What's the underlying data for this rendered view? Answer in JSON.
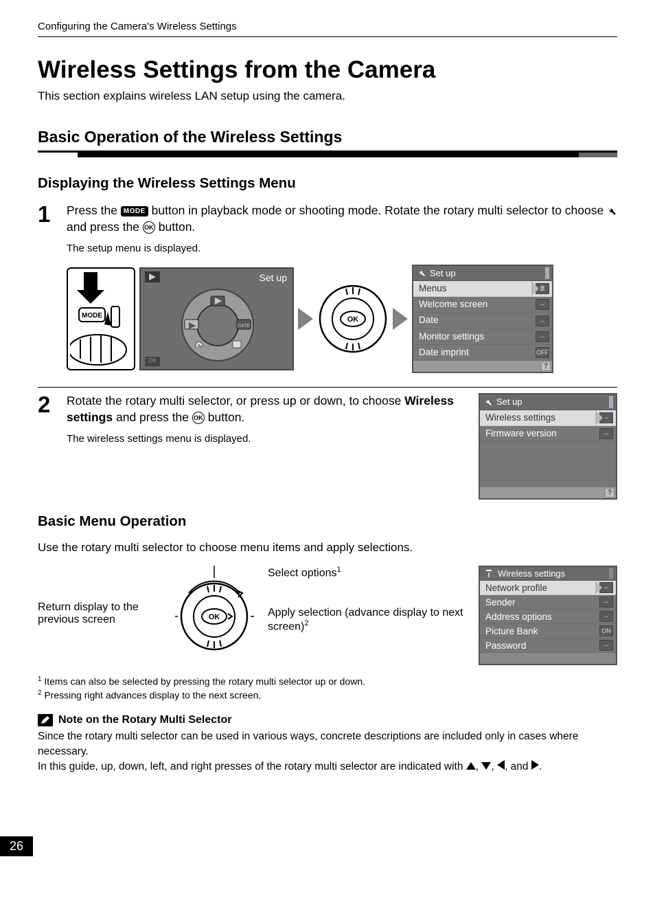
{
  "header": {
    "breadcrumb": "Configuring the Camera's Wireless Settings"
  },
  "title": "Wireless Settings from the Camera",
  "intro": "This section explains wireless LAN setup using the camera.",
  "h2": "Basic Operation of the Wireless Settings",
  "h3a": "Displaying the Wireless Settings Menu",
  "step1": {
    "num": "1",
    "text_a": "Press the ",
    "text_b": " button in playback mode or shooting mode. Rotate the rotary multi selector to choose ",
    "text_c": " and press the ",
    "text_d": " button.",
    "sub": "The setup menu is displayed.",
    "mode_label": "MODE",
    "ok_label": "OK",
    "lcd_dial_title": "Set up"
  },
  "setup_menu": {
    "title": "Set up",
    "rows": [
      {
        "label": "Menus",
        "badge": "≣",
        "sel": true
      },
      {
        "label": "Welcome screen",
        "badge": "--"
      },
      {
        "label": "Date",
        "badge": "--"
      },
      {
        "label": "Monitor settings",
        "badge": "--"
      },
      {
        "label": "Date imprint",
        "badge": "OFF"
      }
    ]
  },
  "step2": {
    "num": "2",
    "text_a": "Rotate the rotary multi selector, or press up or down, to choose ",
    "bold": "Wireless settings",
    "text_b": " and press the ",
    "text_c": " button.",
    "sub": "The wireless settings menu is displayed."
  },
  "setup_menu2": {
    "title": "Set up",
    "rows": [
      {
        "label": "Wireless settings",
        "badge": "--",
        "sel": true
      },
      {
        "label": "Firmware version",
        "badge": "--"
      }
    ]
  },
  "h3b": "Basic Menu Operation",
  "bmo_desc": "Use the rotary multi selector to choose menu items and apply selections.",
  "bmo": {
    "left": "Return display to the previous screen",
    "top": "Select options",
    "top_sup": "1",
    "right_a": "Apply selection (advance display to next screen)",
    "right_sup": "2",
    "ok": "OK"
  },
  "wireless_menu": {
    "title": "Wireless settings",
    "rows": [
      {
        "label": "Network profile",
        "badge": "--",
        "sel": true
      },
      {
        "label": "Sender",
        "badge": "--"
      },
      {
        "label": "Address options",
        "badge": "--"
      },
      {
        "label": "Picture Bank",
        "badge": "ON"
      },
      {
        "label": "Password",
        "badge": "--"
      }
    ]
  },
  "footnotes": {
    "f1": "Items can also be selected by pressing the rotary multi selector up or down.",
    "f2": "Pressing right advances display to the next screen.",
    "sup1": "1",
    "sup2": "2"
  },
  "note": {
    "head": "Note on the Rotary Multi Selector",
    "body1": "Since the rotary multi selector can be used in various ways, concrete descriptions are included only in cases where necessary.",
    "body2a": "In this guide, up, down, left, and right presses of the rotary multi selector are indicated with ",
    "body2b": ", ",
    "body2c": ", ",
    "body2d": ", and ",
    "body2e": "."
  },
  "page_number": "26"
}
